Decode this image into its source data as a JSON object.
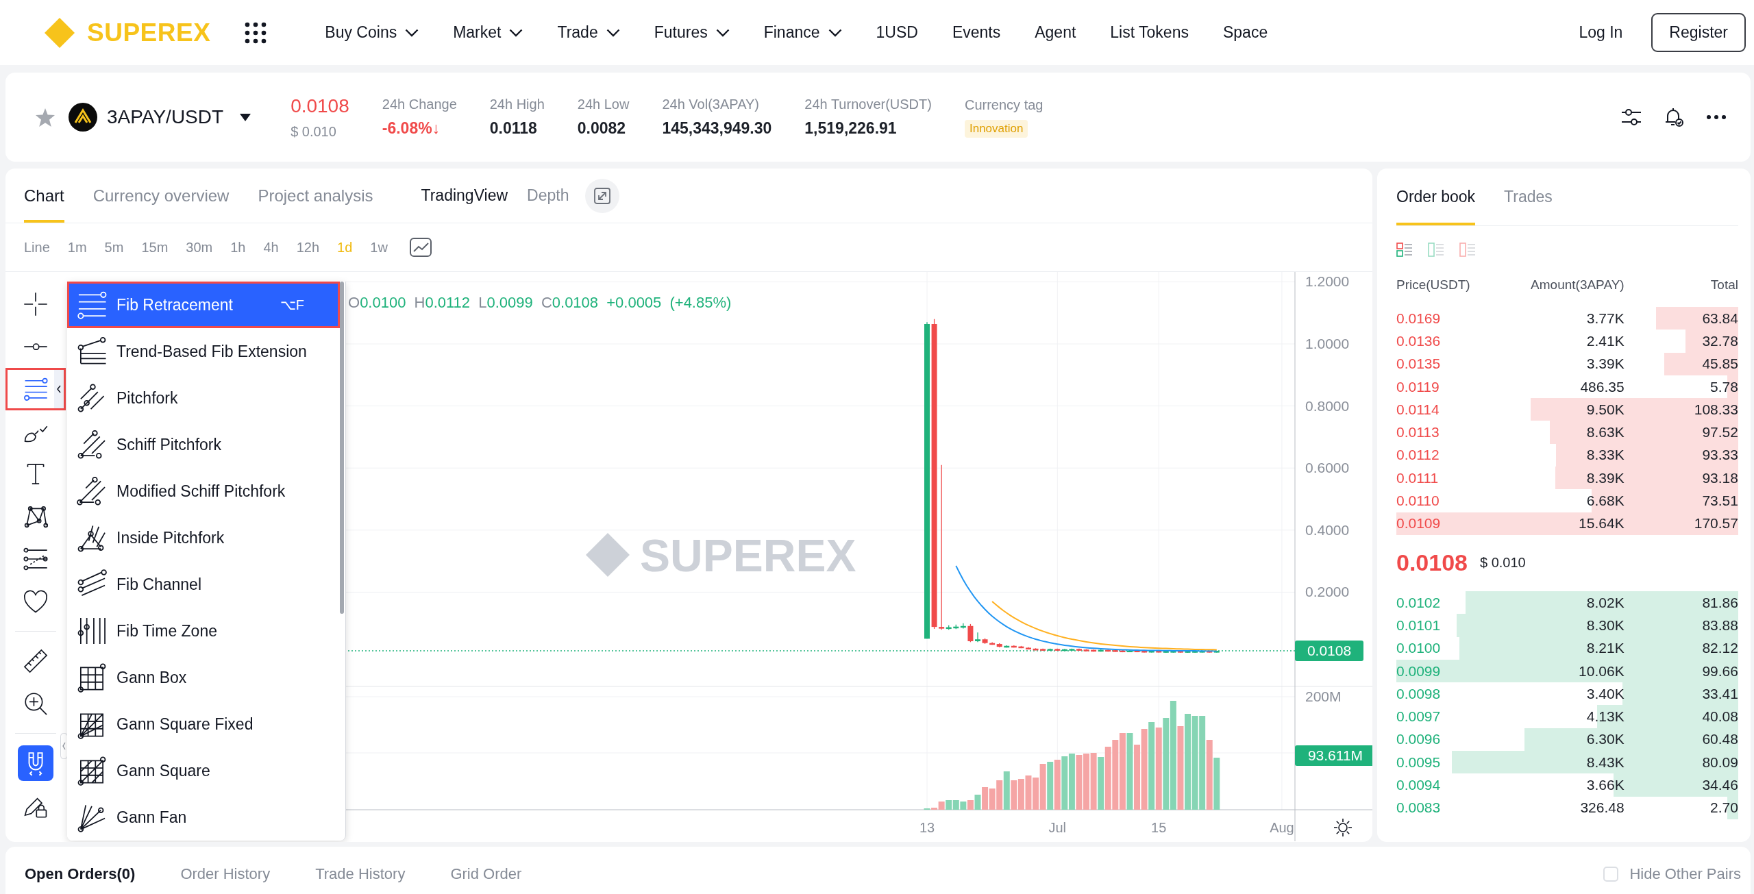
{
  "header": {
    "logo": "SUPEREX",
    "nav": [
      {
        "label": "Buy Coins",
        "dropdown": true
      },
      {
        "label": "Market",
        "dropdown": true
      },
      {
        "label": "Trade",
        "dropdown": true
      },
      {
        "label": "Futures",
        "dropdown": true
      },
      {
        "label": "Finance",
        "dropdown": true
      },
      {
        "label": "1USD",
        "dropdown": false
      },
      {
        "label": "Events",
        "dropdown": false
      },
      {
        "label": "Agent",
        "dropdown": false
      },
      {
        "label": "List Tokens",
        "dropdown": false
      },
      {
        "label": "Space",
        "dropdown": false
      }
    ],
    "login": "Log In",
    "register": "Register"
  },
  "ticker": {
    "favorite": false,
    "pair": "3APAY/USDT",
    "price": "0.0108",
    "price_down": true,
    "price_usd": "$ 0.010",
    "stats": [
      {
        "label": "24h Change",
        "value": "-6.08%↓",
        "down": true
      },
      {
        "label": "24h High",
        "value": "0.0118",
        "down": false
      },
      {
        "label": "24h Low",
        "value": "0.0082",
        "down": false
      },
      {
        "label": "24h Vol(3APAY)",
        "value": "145,343,949.30",
        "down": false
      },
      {
        "label": "24h Turnover(USDT)",
        "value": "1,519,226.91",
        "down": false
      }
    ],
    "currency_tag": {
      "label": "Currency tag",
      "tag": "Innovation"
    }
  },
  "chart_panel": {
    "tabs": [
      {
        "label": "Chart",
        "selected": true
      },
      {
        "label": "Currency overview",
        "selected": false
      },
      {
        "label": "Project analysis",
        "selected": false
      }
    ],
    "views": [
      {
        "label": "TradingView",
        "selected": true
      },
      {
        "label": "Depth",
        "selected": false
      }
    ],
    "intervals": [
      {
        "label": "Line",
        "selected": false
      },
      {
        "label": "1m",
        "selected": false
      },
      {
        "label": "5m",
        "selected": false
      },
      {
        "label": "15m",
        "selected": false
      },
      {
        "label": "30m",
        "selected": false
      },
      {
        "label": "1h",
        "selected": false
      },
      {
        "label": "4h",
        "selected": false
      },
      {
        "label": "12h",
        "selected": false
      },
      {
        "label": "1d",
        "selected": true
      },
      {
        "label": "1w",
        "selected": false
      }
    ],
    "tool_groups": [
      {
        "tools": [
          {
            "kind": "crosshair",
            "selected": false,
            "expanded": false,
            "highlighted": false
          },
          {
            "kind": "trend-line",
            "selected": false,
            "expanded": false,
            "highlighted": false
          },
          {
            "kind": "fib",
            "selected": true,
            "expanded": true,
            "highlighted": true
          },
          {
            "kind": "brush",
            "selected": false,
            "expanded": false,
            "highlighted": false
          },
          {
            "kind": "text",
            "selected": false,
            "expanded": false,
            "highlighted": false
          },
          {
            "kind": "pattern",
            "selected": false,
            "expanded": false,
            "highlighted": false
          },
          {
            "kind": "prediction",
            "selected": false,
            "expanded": false,
            "highlighted": false
          },
          {
            "kind": "favorite",
            "selected": false,
            "expanded": false,
            "highlighted": false
          }
        ]
      },
      {
        "tools": [
          {
            "kind": "ruler",
            "selected": false,
            "expanded": false,
            "highlighted": false
          },
          {
            "kind": "zoom-in",
            "selected": false,
            "expanded": false,
            "highlighted": false
          }
        ]
      },
      {
        "tools": [
          {
            "kind": "magnet",
            "selected": true,
            "expanded": false,
            "highlighted": false
          },
          {
            "kind": "lock-drawings",
            "selected": false,
            "expanded": false,
            "highlighted": false
          }
        ]
      }
    ],
    "drawing_menu": {
      "items": [
        {
          "kind": "fib-retracement",
          "label": "Fib Retracement",
          "shortcut": "⌥F",
          "selected": true,
          "highlighted": true
        },
        {
          "kind": "fib-extension",
          "label": "Trend-Based Fib Extension",
          "selected": false,
          "highlighted": false
        },
        {
          "kind": "pitchfork",
          "label": "Pitchfork",
          "selected": false,
          "highlighted": false
        },
        {
          "kind": "schiff-pitchfork",
          "label": "Schiff Pitchfork",
          "selected": false,
          "highlighted": false
        },
        {
          "kind": "modified-schiff-pitchfork",
          "label": "Modified Schiff Pitchfork",
          "selected": false,
          "highlighted": false
        },
        {
          "kind": "inside-pitchfork",
          "label": "Inside Pitchfork",
          "selected": false,
          "highlighted": false
        },
        {
          "kind": "fib-channel",
          "label": "Fib Channel",
          "selected": false,
          "highlighted": false
        },
        {
          "kind": "fib-time-zone",
          "label": "Fib Time Zone",
          "selected": false,
          "highlighted": false
        },
        {
          "kind": "gann-box",
          "label": "Gann Box",
          "selected": false,
          "highlighted": false
        },
        {
          "kind": "gann-square-fixed",
          "label": "Gann Square Fixed",
          "selected": false,
          "highlighted": false
        },
        {
          "kind": "gann-square",
          "label": "Gann Square",
          "selected": false,
          "highlighted": false
        },
        {
          "kind": "gann-fan",
          "label": "Gann Fan",
          "selected": false,
          "highlighted": false
        }
      ]
    },
    "chart": {
      "legend": [
        {
          "label": "O",
          "value": "0.0100"
        },
        {
          "label": "H",
          "value": "0.0112"
        },
        {
          "label": "L",
          "value": "0.0099"
        },
        {
          "label": "C",
          "value": "0.0108"
        }
      ],
      "legend_change": "+0.0005 (+4.85%)",
      "watermark": "SUPEREX",
      "price_ticks": [
        "1.2000",
        "1.0000",
        "0.8000",
        "0.6000",
        "0.4000",
        "0.2000"
      ],
      "last_price": "0.0108",
      "volume_tick": "200M",
      "last_volume": "93.611M",
      "time_ticks": [
        "13",
        "Jul",
        "15",
        "Aug"
      ]
    }
  },
  "order_book": {
    "tabs": [
      {
        "label": "Order book",
        "selected": true
      },
      {
        "label": "Trades",
        "selected": false
      }
    ],
    "views": [
      {
        "kind": "both",
        "selected": true
      },
      {
        "kind": "bids",
        "selected": false
      },
      {
        "kind": "asks",
        "selected": false
      }
    ],
    "columns": [
      "Price(USDT)",
      "Amount(3APAY)",
      "Total"
    ],
    "asks": [
      {
        "price": "0.0169",
        "amount": "3.77K",
        "total": "63.84",
        "level": 0.24
      },
      {
        "price": "0.0136",
        "amount": "2.41K",
        "total": "32.78",
        "level": 0.155
      },
      {
        "price": "0.0135",
        "amount": "3.39K",
        "total": "45.85",
        "level": 0.217
      },
      {
        "price": "0.0119",
        "amount": "486.35",
        "total": "5.78",
        "level": 0.032
      },
      {
        "price": "0.0114",
        "amount": "9.50K",
        "total": "108.33",
        "level": 0.607
      },
      {
        "price": "0.0113",
        "amount": "8.63K",
        "total": "97.52",
        "level": 0.552
      },
      {
        "price": "0.0112",
        "amount": "8.33K",
        "total": "93.33",
        "level": 0.533
      },
      {
        "price": "0.0111",
        "amount": "8.39K",
        "total": "93.18",
        "level": 0.536
      },
      {
        "price": "0.0110",
        "amount": "6.68K",
        "total": "73.51",
        "level": 0.428
      },
      {
        "price": "0.0109",
        "amount": "15.64K",
        "total": "170.57",
        "level": 1.0
      }
    ],
    "last_price": "0.0108",
    "last_price_usd": "$ 0.010",
    "price_down": true,
    "bids": [
      {
        "price": "0.0102",
        "amount": "8.02K",
        "total": "81.86",
        "level": 0.797
      },
      {
        "price": "0.0101",
        "amount": "8.30K",
        "total": "83.88",
        "level": 0.824
      },
      {
        "price": "0.0100",
        "amount": "8.21K",
        "total": "82.12",
        "level": 0.815
      },
      {
        "price": "0.0099",
        "amount": "10.06K",
        "total": "99.66",
        "level": 1.0
      },
      {
        "price": "0.0098",
        "amount": "3.40K",
        "total": "33.41",
        "level": 0.338
      },
      {
        "price": "0.0097",
        "amount": "4.13K",
        "total": "40.08",
        "level": 0.413
      },
      {
        "price": "0.0096",
        "amount": "6.30K",
        "total": "60.48",
        "level": 0.626
      },
      {
        "price": "0.0095",
        "amount": "8.43K",
        "total": "80.09",
        "level": 0.838
      },
      {
        "price": "0.0094",
        "amount": "3.66K",
        "total": "34.46",
        "level": 0.364
      },
      {
        "price": "0.0083",
        "amount": "326.48",
        "total": "2.70",
        "level": 0.032
      }
    ]
  },
  "bottom": {
    "tabs": [
      {
        "label": "Open Orders(0)",
        "selected": true
      },
      {
        "label": "Order History",
        "selected": false
      },
      {
        "label": "Trade History",
        "selected": false
      },
      {
        "label": "Grid Order",
        "selected": false
      }
    ],
    "hide_other_pairs": {
      "label": "Hide Other Pairs",
      "checked": false
    }
  }
}
